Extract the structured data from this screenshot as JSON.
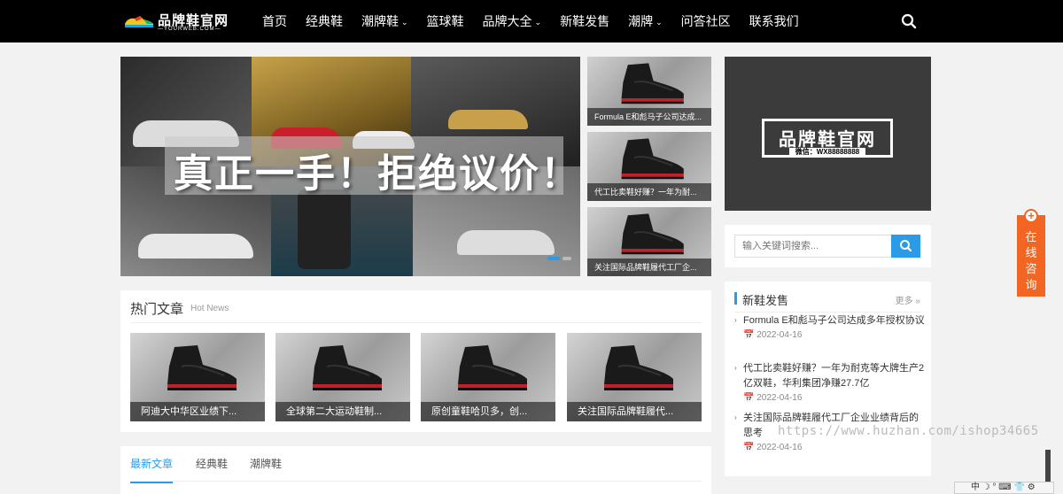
{
  "header": {
    "logo_name": "品牌鞋官网",
    "logo_sub": "—YOURWEB.COM—",
    "nav": [
      {
        "label": "首页",
        "caret": ""
      },
      {
        "label": "经典鞋",
        "caret": ""
      },
      {
        "label": "潮牌鞋",
        "caret": "⌄"
      },
      {
        "label": "篮球鞋",
        "caret": ""
      },
      {
        "label": "品牌大全",
        "caret": "⌄"
      },
      {
        "label": "新鞋发售",
        "caret": ""
      },
      {
        "label": "潮牌",
        "caret": "⌄"
      },
      {
        "label": "问答社区",
        "caret": ""
      },
      {
        "label": "联系我们",
        "caret": ""
      }
    ]
  },
  "slider": {
    "headline": "真正一手！拒绝议价！"
  },
  "side_thumbs": [
    {
      "caption": "Formula E和彪马子公司达成..."
    },
    {
      "caption": "代工比卖鞋好赚？一年为耐..."
    },
    {
      "caption": "关注国际品牌鞋履代工厂企..."
    }
  ],
  "brandbox": {
    "name": "品牌鞋官网",
    "wechat": "微信：WX88888888"
  },
  "sidebar_search": {
    "placeholder": "输入关键词搜索..."
  },
  "new_release": {
    "title": "新鞋发售",
    "more": "更多 »",
    "items": [
      {
        "title": "Formula E和彪马子公司达成多年授权协议",
        "date": "📅 2022-04-16"
      },
      {
        "title": "代工比卖鞋好赚？一年为耐克等大牌生产2亿双鞋，华利集团净赚27.7亿",
        "date": "📅 2022-04-16"
      },
      {
        "title": "关注国际品牌鞋履代工厂企业业绩背后的思考",
        "date": "📅 2022-04-16"
      }
    ]
  },
  "hot_news": {
    "title": "热门文章",
    "subtitle": "Hot News",
    "cards": [
      {
        "caption": "阿迪大中华区业绩下..."
      },
      {
        "caption": "全球第二大运动鞋制..."
      },
      {
        "caption": "原创童鞋哈贝多，创..."
      },
      {
        "caption": "关注国际品牌鞋履代..."
      }
    ]
  },
  "tabs": [
    {
      "label": "最新文章",
      "active": true
    },
    {
      "label": "经典鞋",
      "active": false
    },
    {
      "label": "潮牌鞋",
      "active": false
    }
  ],
  "consult": {
    "label": "在线咨询"
  },
  "watermark": "https://www.huzhan.com/ishop34665",
  "ime_bar": "中 ☽ ° ⌨ 👕 ⚙",
  "colors": {
    "accent": "#2b9be8",
    "header_bg": "#000000",
    "consult_bg": "#f26522",
    "brandbox_bg": "#3b3b3b"
  }
}
